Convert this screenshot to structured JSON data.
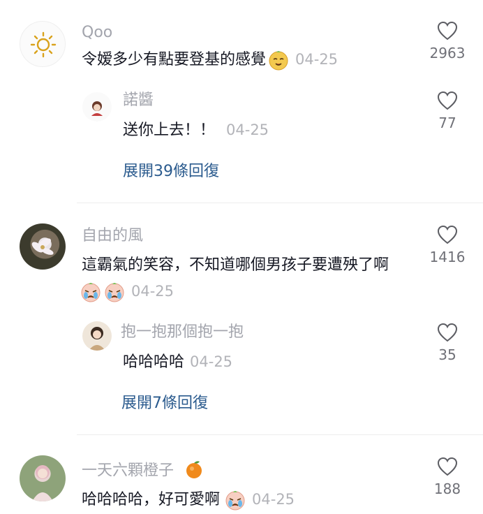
{
  "comments": [
    {
      "username": "Qoo",
      "text": "令嫒多少有點要登基的感覺",
      "date": "04-25",
      "likes": "2963",
      "avatar_icon": "sun-icon",
      "reply": {
        "username": "諾醬",
        "text": "送你上去！！",
        "date": "04-25",
        "likes": "77"
      },
      "expand_label": "展開39條回復"
    },
    {
      "username": "自由的風",
      "text": "這霸氣的笑容，不知道哪個男孩子要遭殃了啊",
      "date": "04-25",
      "likes": "1416",
      "avatar_icon": "flower-photo",
      "reply": {
        "username": "抱一抱那個抱一抱",
        "text": "哈哈哈哈",
        "date": "04-25",
        "likes": "35"
      },
      "expand_label": "展開7條回復"
    },
    {
      "username": "一天六顆橙子",
      "text": "哈哈哈哈，好可愛啊",
      "date": "04-25",
      "likes": "188",
      "avatar_icon": "girl-photo",
      "username_emoji": "orange-icon"
    }
  ],
  "colors": {
    "username": "#a3a5ad",
    "text": "#161823",
    "date": "#b2b3b8",
    "link": "#2b5b8e",
    "heart_stroke": "#5c5d63"
  }
}
